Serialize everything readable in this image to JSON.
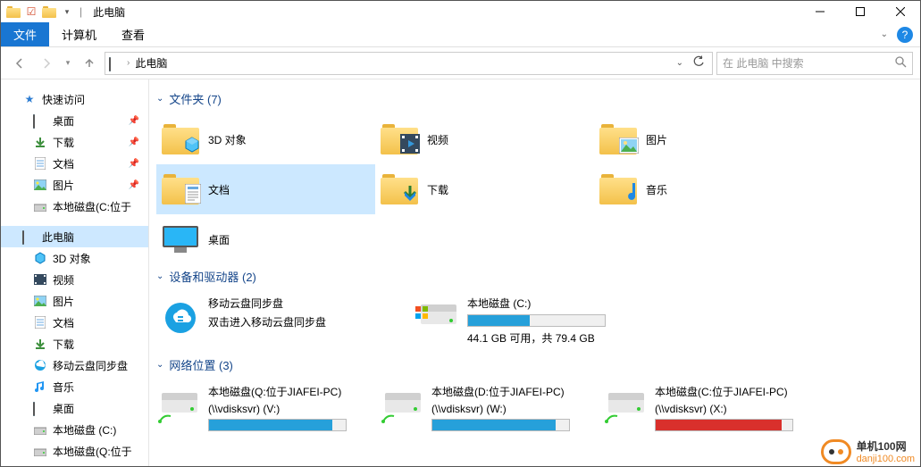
{
  "title": "此电脑",
  "ribbon": {
    "file": "文件",
    "computer": "计算机",
    "view": "查看"
  },
  "nav": {
    "location": "此电脑",
    "search_placeholder": "在 此电脑 中搜索"
  },
  "sidebar": {
    "quick_access": "快速访问",
    "qa_items": [
      {
        "label": "桌面",
        "pinned": true
      },
      {
        "label": "下载",
        "pinned": true
      },
      {
        "label": "文档",
        "pinned": true
      },
      {
        "label": "图片",
        "pinned": true
      },
      {
        "label": "本地磁盘(C:位于",
        "pinned": false
      }
    ],
    "this_pc": "此电脑",
    "pc_items": [
      "3D 对象",
      "视频",
      "图片",
      "文档",
      "下载",
      "移动云盘同步盘",
      "音乐",
      "桌面",
      "本地磁盘 (C:)",
      "本地磁盘(Q:位于"
    ]
  },
  "groups": {
    "folders": {
      "header": "文件夹 (7)",
      "items": [
        "3D 对象",
        "视频",
        "图片",
        "文档",
        "下载",
        "音乐",
        "桌面"
      ]
    },
    "devices": {
      "header": "设备和驱动器 (2)",
      "cloud": {
        "name": "移动云盘同步盘",
        "sub": "双击进入移动云盘同步盘"
      },
      "local_c": {
        "name": "本地磁盘 (C:)",
        "sub": "44.1 GB 可用，共 79.4 GB",
        "fill_pct": 45,
        "color": "#26a0da"
      }
    },
    "network": {
      "header": "网络位置 (3)",
      "items": [
        {
          "line1": "本地磁盘(Q:位于JIAFEI-PC)",
          "line2": "(\\\\vdisksvr) (V:)",
          "fill_pct": 90,
          "color": "#26a0da"
        },
        {
          "line1": "本地磁盘(D:位于JIAFEI-PC)",
          "line2": "(\\\\vdisksvr) (W:)",
          "fill_pct": 90,
          "color": "#26a0da"
        },
        {
          "line1": "本地磁盘(C:位于JIAFEI-PC)",
          "line2": "(\\\\vdisksvr) (X:)",
          "fill_pct": 92,
          "color": "#d9302c"
        }
      ]
    }
  },
  "watermark": {
    "line1": "单机100网",
    "line2": "danji100.com"
  }
}
